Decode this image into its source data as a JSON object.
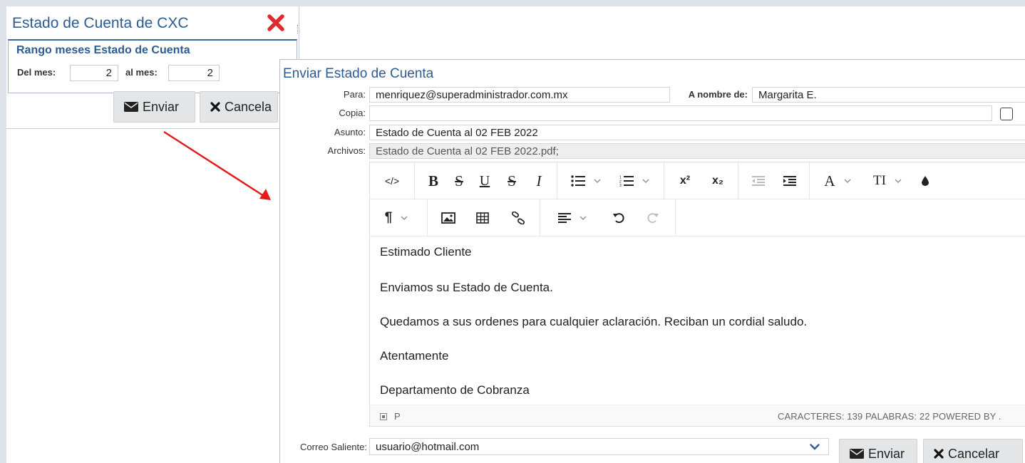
{
  "back_dialog": {
    "title": "Estado de Cuenta de CXC",
    "section_title": "Rango meses Estado de Cuenta",
    "from_label": "Del mes:",
    "from_value": "2",
    "to_label": "al mes:",
    "to_value": "2",
    "send_label": "Enviar",
    "cancel_label": "Cancela"
  },
  "email_dialog": {
    "title": "Enviar Estado de Cuenta",
    "to_label": "Para:",
    "to_value": "menriquez@superadministrador.com.mx",
    "name_label": "A nombre de:",
    "name_value": "Margarita E.",
    "cc_label": "Copia:",
    "cc_value": "",
    "subject_label": "Asunto:",
    "subject_value": "Estado de Cuenta al 02 FEB 2022",
    "files_label": "Archivos:",
    "files_value": "Estado de Cuenta al 02 FEB 2022.pdf;",
    "outgoing_label": "Correo Saliente:",
    "outgoing_value": "usuario@hotmail.com",
    "send_label": "Enviar",
    "cancel_label": "Cancelar"
  },
  "editor": {
    "toolbar": {
      "code": "</>",
      "bold": "B",
      "strike": "S",
      "underline": "U",
      "strike2": "S",
      "italic": "I",
      "superscript": "x²",
      "subscript": "x₂",
      "font_color": "A",
      "font_size": "TI",
      "paragraph": "¶"
    },
    "body": [
      "Estimado Cliente",
      "Enviamos su Estado de Cuenta.",
      "Quedamos a sus ordenes para cualquier aclaración. Reciban un cordial saludo.",
      "Atentamente",
      "Departamento de Cobranza"
    ],
    "status_path": "P",
    "status_stats": "CARACTERES: 139  PALABRAS: 22  POWERED BY ."
  },
  "colors": {
    "title_blue": "#2d5b92",
    "close_red": "#e02b2b",
    "arrow_red": "#e31b1b",
    "button_gray": "#e4e5e6"
  },
  "icons": [
    "close-icon",
    "envelope-icon",
    "x-mark-icon",
    "chevron-down-icon",
    "checkbox-icon",
    "code-view-icon",
    "bold-icon",
    "strikethrough-icon",
    "underline-icon",
    "italic-icon",
    "bullet-list-icon",
    "numbered-list-icon",
    "superscript-icon",
    "subscript-icon",
    "outdent-icon",
    "indent-icon",
    "font-color-icon",
    "font-size-icon",
    "ink-drop-icon",
    "paragraph-icon",
    "image-icon",
    "table-icon",
    "link-icon",
    "align-icon",
    "undo-icon",
    "redo-icon",
    "element-path-icon"
  ]
}
